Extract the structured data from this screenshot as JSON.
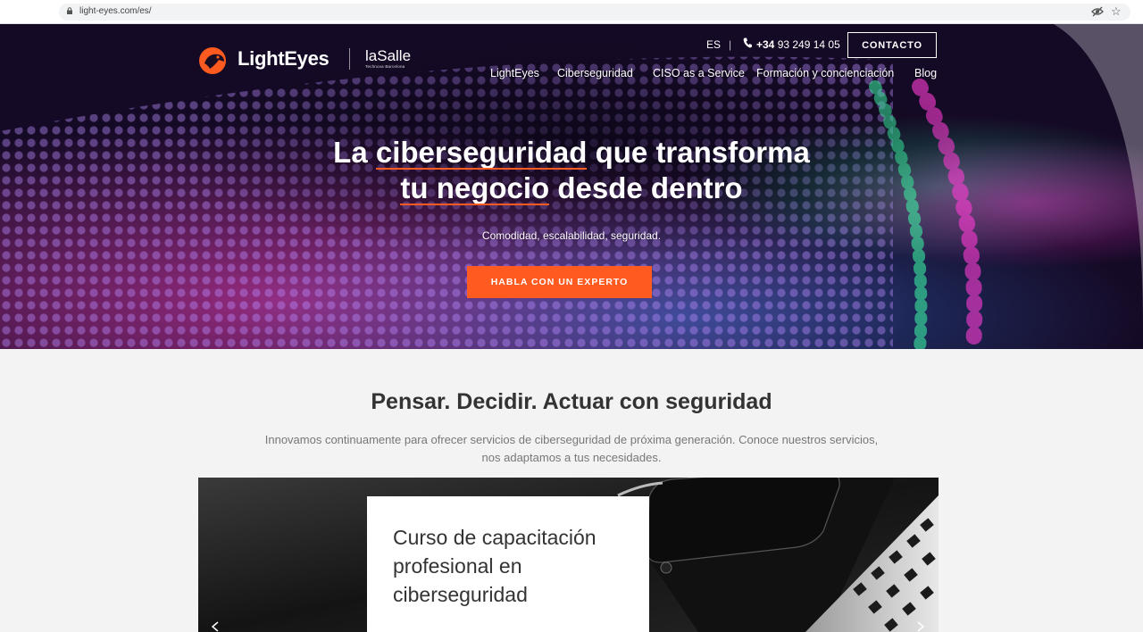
{
  "browser": {
    "url": "light-eyes.com/es/",
    "icons": [
      "lock-icon",
      "eye-off-icon",
      "star-icon"
    ]
  },
  "header": {
    "brand": "LightEyes",
    "partner": "laSalle",
    "partner_sub": "Technova Barcelona",
    "language": "ES",
    "separator": "|",
    "phone_prefix": "+34",
    "phone_number": " 93 249 14 05",
    "contact_button": "CONTACTO",
    "nav": [
      "LightEyes",
      "Ciberseguridad",
      "CISO as a Service",
      "Formación y concienciación",
      "Blog"
    ]
  },
  "hero": {
    "headline_line1_pre": "La ",
    "headline_line1_ul": "ciberseguridad",
    "headline_line1_post": " que transforma",
    "headline_line2_ul": "tu negocio",
    "headline_line2_post": " desde dentro",
    "tagline": "Comodidad, escalabilidad, seguridad.",
    "cta": "HABLA CON UN EXPERTO"
  },
  "section": {
    "title": "Pensar. Decidir. Actuar con seguridad",
    "text": "Innovamos continuamente para ofrecer servicios de ciberseguridad de próxima generación. Conoce nuestros servicios, nos adaptamos a tus necesidades."
  },
  "feature": {
    "card_title": "Curso de capacitación profesional en ciberseguridad"
  },
  "colors": {
    "accent": "#ff5a1f",
    "hero_bg": "#120820",
    "section_bg": "#f3f3f3",
    "heading": "#333333",
    "body_text": "#777777"
  }
}
